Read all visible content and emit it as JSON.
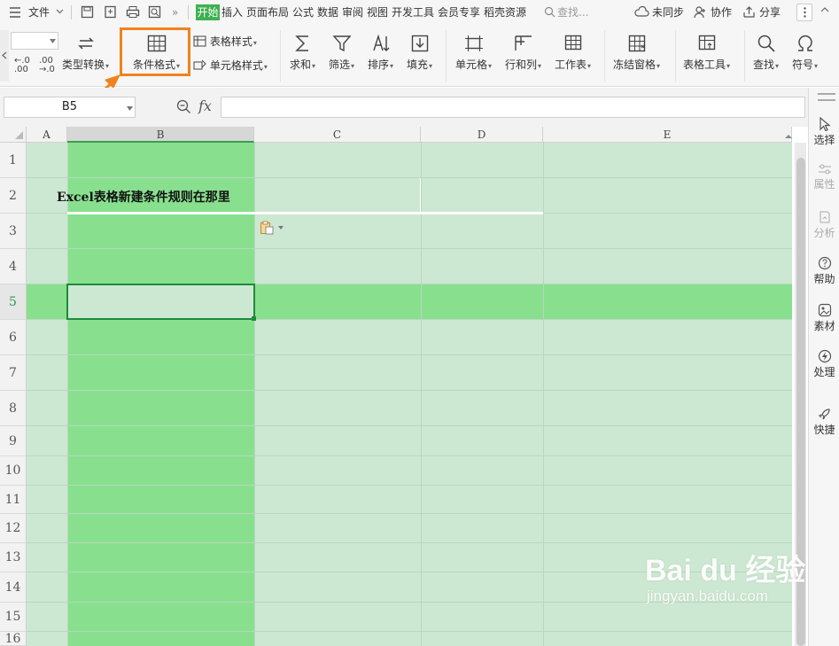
{
  "menubar": {
    "file_label": "文件",
    "tabs": [
      "开始",
      "插入",
      "页面布局",
      "公式",
      "数据",
      "审阅",
      "视图",
      "开发工具",
      "会员专享",
      "稻壳资源"
    ],
    "search_placeholder": "查找...",
    "sync_label": "未同步",
    "collab_label": "协作",
    "share_label": "分享"
  },
  "ribbon": {
    "type_convert": "类型转换",
    "cond_format": "条件格式",
    "table_style": "表格样式",
    "cell_style": "单元格样式",
    "sum": "求和",
    "filter": "筛选",
    "sort": "排序",
    "fill": "填充",
    "cell": "单元格",
    "rowcol": "行和列",
    "worksheet": "工作表",
    "freeze": "冻结窗格",
    "table_tools": "表格工具",
    "find": "查找",
    "symbol": "符号"
  },
  "formula_bar": {
    "cell_ref": "B5",
    "fx_label": "fx",
    "content": ""
  },
  "columns": [
    "A",
    "B",
    "C",
    "D",
    "E"
  ],
  "selected_column": "B",
  "rows": [
    "1",
    "2",
    "3",
    "4",
    "5",
    "6",
    "7",
    "8",
    "9",
    "10",
    "11",
    "12",
    "13",
    "14",
    "15",
    "16"
  ],
  "selected_row": "5",
  "cell_B2_text": "Excel表格新建条件规则在那里",
  "sidebar": [
    "选择",
    "属性",
    "分析",
    "帮助",
    "素材",
    "处理",
    "快捷"
  ],
  "watermark": {
    "brand": "Bai du 经验",
    "url": "jingyan.baidu.com"
  },
  "colors": {
    "accent_green": "#3fb04f",
    "highlight_orange": "#f0821e",
    "selected_fill": "#88e08e",
    "cell_fill": "#cde8d2"
  }
}
